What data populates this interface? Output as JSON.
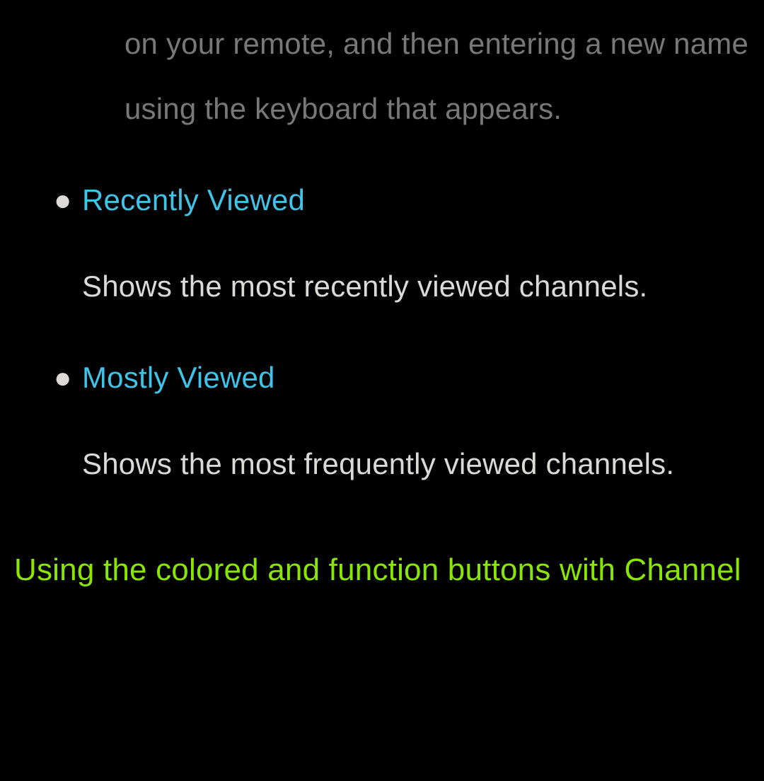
{
  "trailing_paragraph": "on your remote, and then entering a new name using the keyboard that appears.",
  "items": [
    {
      "title": "Recently Viewed",
      "description": "Shows the most recently viewed channels."
    },
    {
      "title": "Mostly Viewed",
      "description": "Shows the most frequently viewed channels."
    }
  ],
  "section_heading": "Using the colored and function buttons with Channel",
  "bullet_char": "●"
}
